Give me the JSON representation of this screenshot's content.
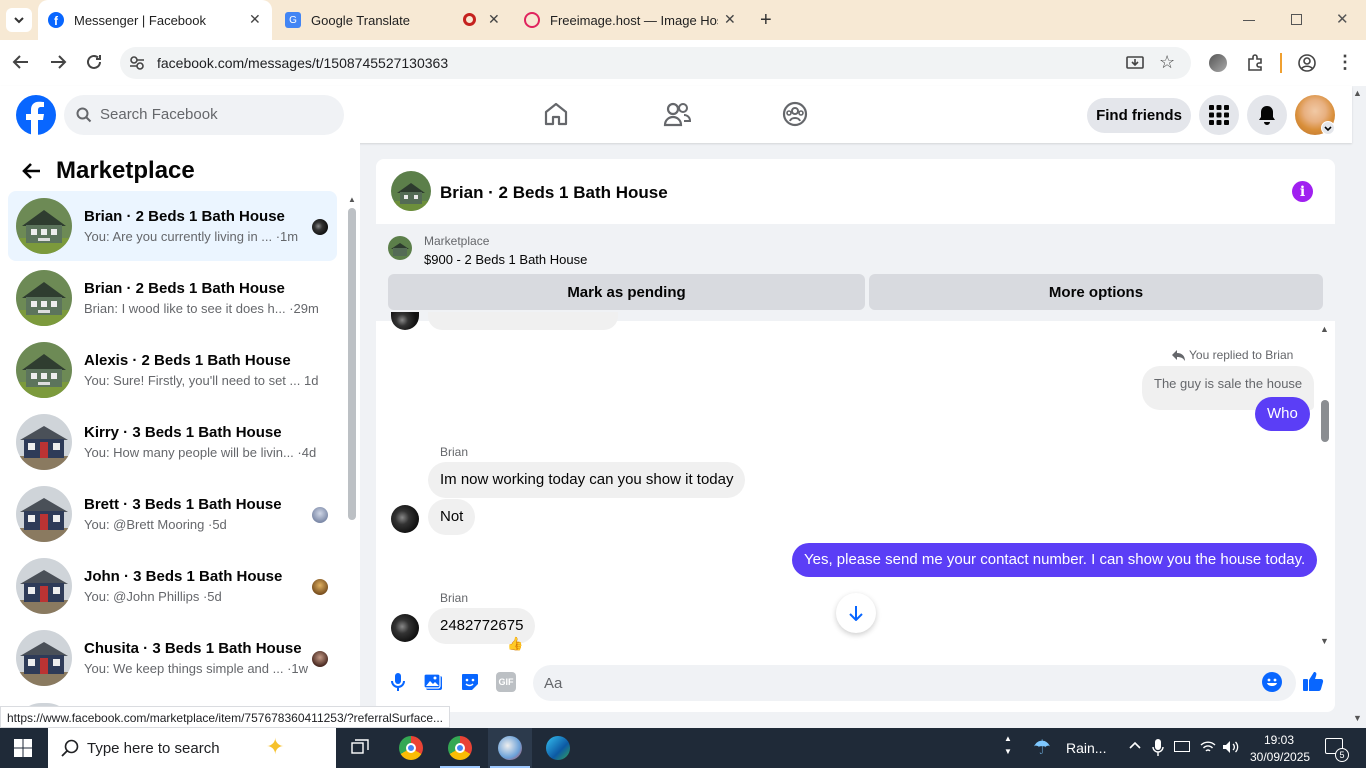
{
  "browser": {
    "tabs": [
      {
        "title": "Messenger | Facebook",
        "active": true
      },
      {
        "title": "Google Translate",
        "active": false
      },
      {
        "title": "Freeimage.host — Image Hostin",
        "active": false
      }
    ],
    "url": "facebook.com/messages/t/1508745527130363",
    "status_url": "https://www.facebook.com/marketplace/item/757678360411253/?referralSurface..."
  },
  "fb_nav": {
    "search_placeholder": "Search Facebook",
    "find_friends": "Find friends"
  },
  "sidebar": {
    "title": "Marketplace",
    "conversations": [
      {
        "name": "Brian · 2 Beds 1 Bath House",
        "preview": "You: Are you currently living in ... ·1m",
        "selected": true,
        "thumb": "green-house"
      },
      {
        "name": "Brian · 2 Beds 1 Bath House",
        "preview": "Brian: I wood like to see it does h... ·29m",
        "selected": false,
        "thumb": "green-house"
      },
      {
        "name": "Alexis · 2 Beds 1 Bath House",
        "preview": "You: Sure! Firstly, you'll need to set ... 1d",
        "selected": false,
        "thumb": "green-house"
      },
      {
        "name": "Kirry · 3 Beds 1 Bath House",
        "preview": "You: How many people will be livin... ·4d",
        "selected": false,
        "thumb": "blue-house"
      },
      {
        "name": "Brett · 3 Beds 1 Bath House",
        "preview": "You: @Brett Mooring ·5d",
        "selected": false,
        "thumb": "blue-house"
      },
      {
        "name": "John · 3 Beds 1 Bath House",
        "preview": "You: @John Phillips ·5d",
        "selected": false,
        "thumb": "blue-house"
      },
      {
        "name": "Chusita · 3 Beds 1 Bath House",
        "preview": "You: We keep things simple and ... ·1w",
        "selected": false,
        "thumb": "blue-house"
      }
    ]
  },
  "chat": {
    "title": "Brian · 2 Beds 1 Bath House",
    "listing_label": "Marketplace",
    "listing_title": "$900 - 2 Beds 1 Bath House",
    "mark_pending": "Mark as pending",
    "more_options": "More options",
    "replied_label": "You replied to Brian",
    "quoted_text": "The guy is sale the house",
    "messages": [
      {
        "from": "me",
        "text": "Who"
      },
      {
        "from": "Brian",
        "sender": "Brian",
        "text": "Im now working today can you show it today"
      },
      {
        "from": "Brian",
        "text": "Not"
      },
      {
        "from": "me",
        "text": "Yes, please send me your contact number. I can show you the house today."
      },
      {
        "from": "Brian",
        "sender": "Brian",
        "text": "2482772675",
        "reaction": "👍"
      }
    ],
    "composer_placeholder": "Aa"
  },
  "taskbar": {
    "search_placeholder": "Type here to search",
    "weather": "Rain...",
    "time": "19:03",
    "date": "30/09/2025",
    "notifications": "5"
  },
  "colors": {
    "fb_blue": "#0866ff",
    "messenger_purple": "#5b3ef6",
    "tab_bar": "#f7e9d4"
  }
}
